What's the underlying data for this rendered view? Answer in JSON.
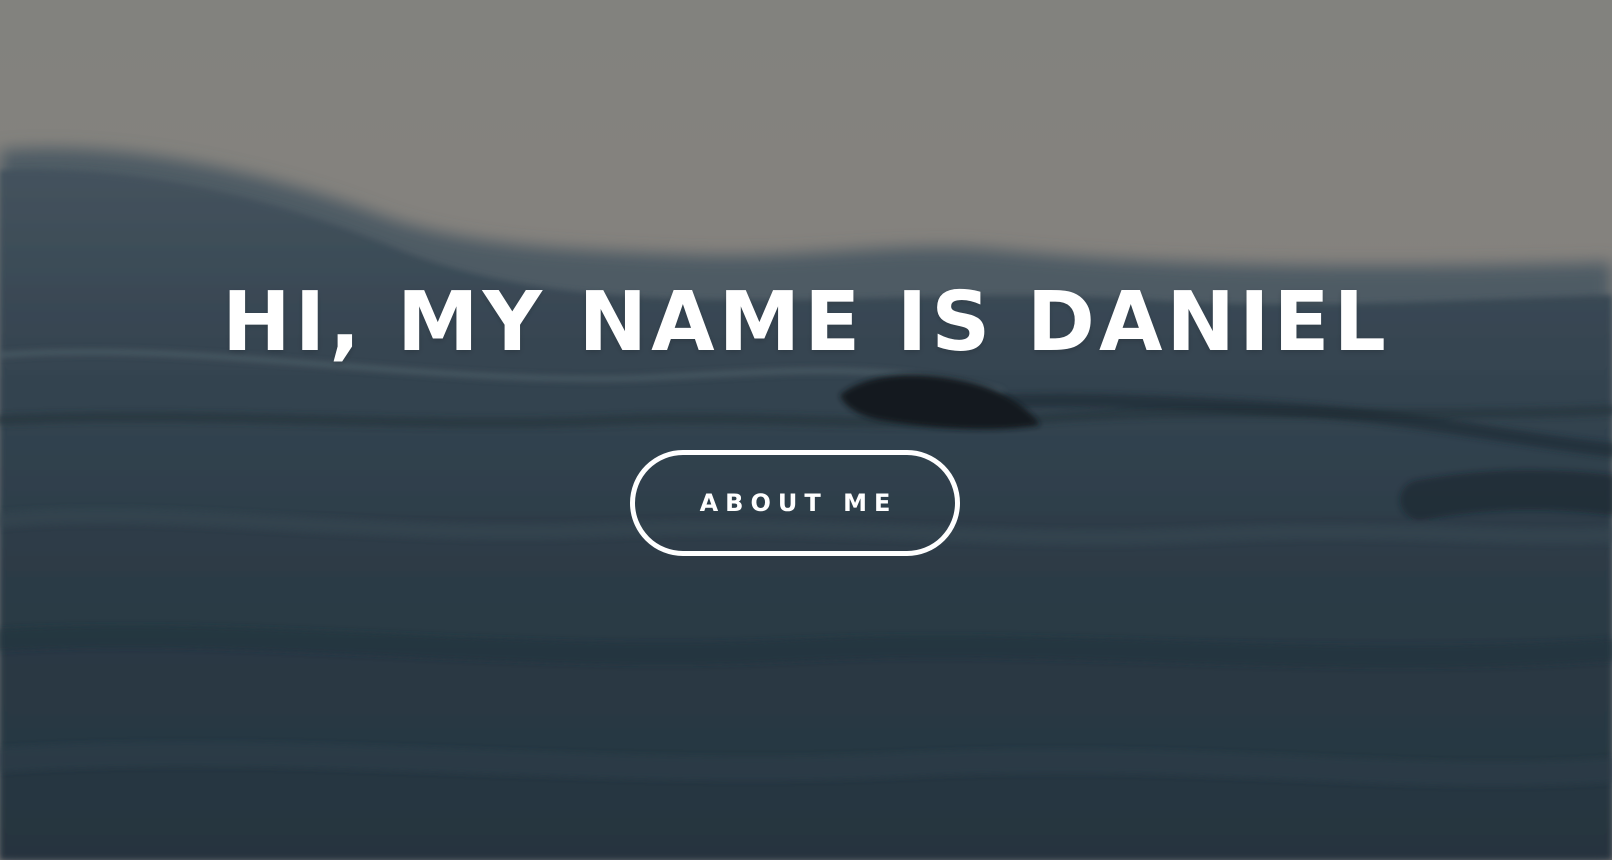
{
  "hero": {
    "title": "HI, MY NAME IS DANIEL",
    "button_label": "ABOUT ME"
  },
  "background": {
    "subject": "ocean-wave-photo",
    "sky_color": "#928f8b",
    "water_color": "#2e3f4c"
  }
}
